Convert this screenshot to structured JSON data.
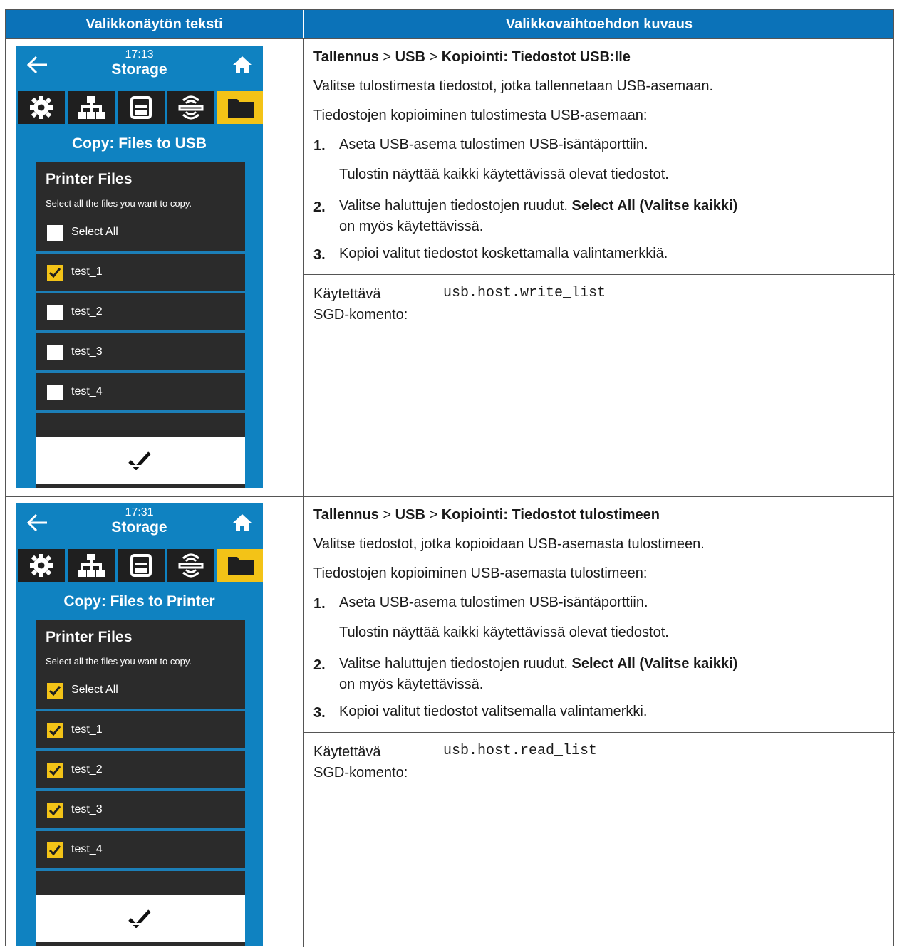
{
  "header": {
    "left": "Valikkonäytön teksti",
    "right": "Valikkovaihtoehdon kuvaus"
  },
  "rows": [
    {
      "screen": {
        "time": "17:13",
        "title": "Storage",
        "heading": "Copy: Files to USB",
        "panel_title": "Printer Files",
        "panel_sub": "Select all the files you want to copy.",
        "items": [
          {
            "label": "Select All",
            "checked": false
          },
          {
            "label": "test_1",
            "checked": true
          },
          {
            "label": "test_2",
            "checked": false
          },
          {
            "label": "test_3",
            "checked": false
          },
          {
            "label": "test_4",
            "checked": false
          }
        ]
      },
      "crumb": {
        "a": "Tallennus",
        "sep1": " > ",
        "b": "USB",
        "sep2": " > ",
        "c": "Kopiointi: Tiedostot USB:lle"
      },
      "intro": "Valitse tulostimesta tiedostot, jotka tallennetaan USB-asemaan.",
      "lead": "Tiedostojen kopioiminen tulostimesta USB-asemaan:",
      "step1": "Aseta USB-asema tulostimen USB-isäntäporttiin.",
      "step1_note": "Tulostin näyttää kaikki käytettävissä olevat tiedostot.",
      "step2_pre": "Valitse haluttujen tiedostojen ruudut. ",
      "step2_bold": "Select All (Valitse kaikki)",
      "step2_post": "on myös käytettävissä.",
      "step3": "Kopioi valitut tiedostot koskettamalla valintamerkkiä.",
      "sgd_label": "Käytettävä SGD-komento:",
      "sgd_code": "usb.host.write_list"
    },
    {
      "screen": {
        "time": "17:31",
        "title": "Storage",
        "heading": "Copy: Files to Printer",
        "panel_title": "Printer Files",
        "panel_sub": "Select all the files you want to copy.",
        "items": [
          {
            "label": "Select All",
            "checked": true
          },
          {
            "label": "test_1",
            "checked": true
          },
          {
            "label": "test_2",
            "checked": true
          },
          {
            "label": "test_3",
            "checked": true
          },
          {
            "label": "test_4",
            "checked": true
          }
        ]
      },
      "crumb": {
        "a": "Tallennus",
        "sep1": " > ",
        "b": "USB",
        "sep2": " > ",
        "c": "Kopiointi: Tiedostot tulostimeen"
      },
      "intro": "Valitse tiedostot, jotka kopioidaan USB-asemasta tulostimeen.",
      "lead": "Tiedostojen kopioiminen USB-asemasta tulostimeen:",
      "step1": "Aseta USB-asema tulostimen USB-isäntäporttiin.",
      "step1_note": "Tulostin näyttää kaikki käytettävissä olevat tiedostot.",
      "step2_pre": "Valitse haluttujen tiedostojen ruudut. ",
      "step2_bold": "Select All (Valitse kaikki)",
      "step2_post": "on myös käytettävissä.",
      "step3": "Kopioi valitut tiedostot valitsemalla valintamerkki.",
      "sgd_label": "Käytettävä SGD-komento:",
      "sgd_code": "usb.host.read_list"
    }
  ],
  "step_numbers": [
    "1.",
    "2.",
    "3."
  ],
  "colors": {
    "header_bg": "#0b72b8",
    "screen_bg": "#0f82c1",
    "accent": "#f3c317",
    "panel": "#2b2b2b"
  }
}
